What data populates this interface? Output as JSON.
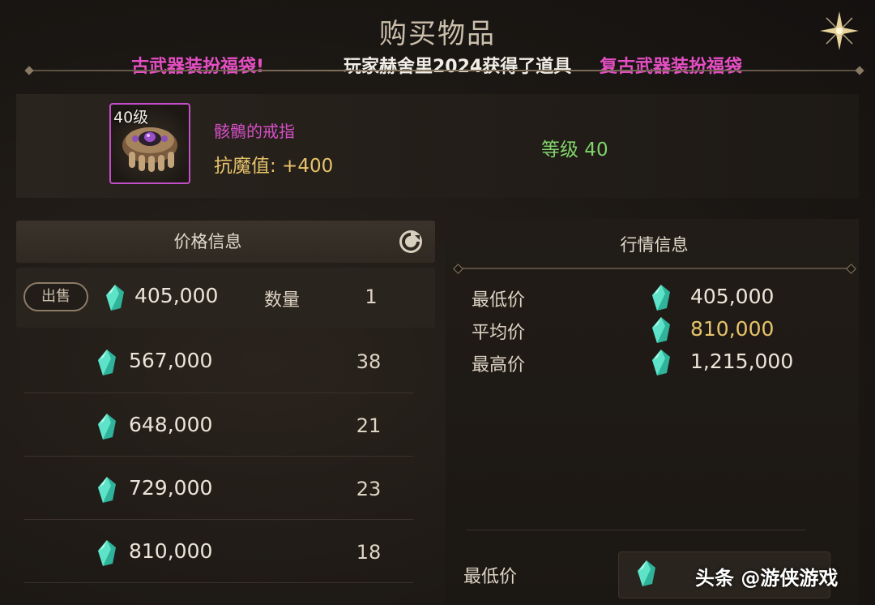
{
  "title": "购买物品",
  "ticker": {
    "part1": "古武器装扮福袋!",
    "part2": "玩家赫舍里2024获得了道具",
    "part3": "复古武器装扮福袋"
  },
  "item": {
    "level_badge": "40级",
    "name": "骸鶻的戒指",
    "stat": "抗魔值: +400",
    "grade": "等级 40",
    "icon": "skull-ring-icon",
    "rarity_color": "#c24fc7"
  },
  "price_panel": {
    "header": "价格信息",
    "refresh_icon": "refresh-icon",
    "sell_button": "出售",
    "quantity_label": "数量",
    "first": {
      "price": "405,000",
      "qty": "1"
    },
    "rows": [
      {
        "price": "567,000",
        "qty": "38"
      },
      {
        "price": "648,000",
        "qty": "21"
      },
      {
        "price": "729,000",
        "qty": "23"
      },
      {
        "price": "810,000",
        "qty": "18"
      }
    ]
  },
  "market_panel": {
    "title": "行情信息",
    "min_label": "最低价",
    "min_value": "405,000",
    "avg_label": "平均价",
    "avg_value": "810,000",
    "max_label": "最高价",
    "max_value": "1,215,000",
    "bottom_label": "最低价"
  },
  "currency_icon": "gem-icon",
  "watermark": "头条 @游侠游戏",
  "colors": {
    "magenta": "#e64fc4",
    "gold": "#e7c36a",
    "green": "#7fd36a",
    "gem": "#3fd1b8"
  }
}
